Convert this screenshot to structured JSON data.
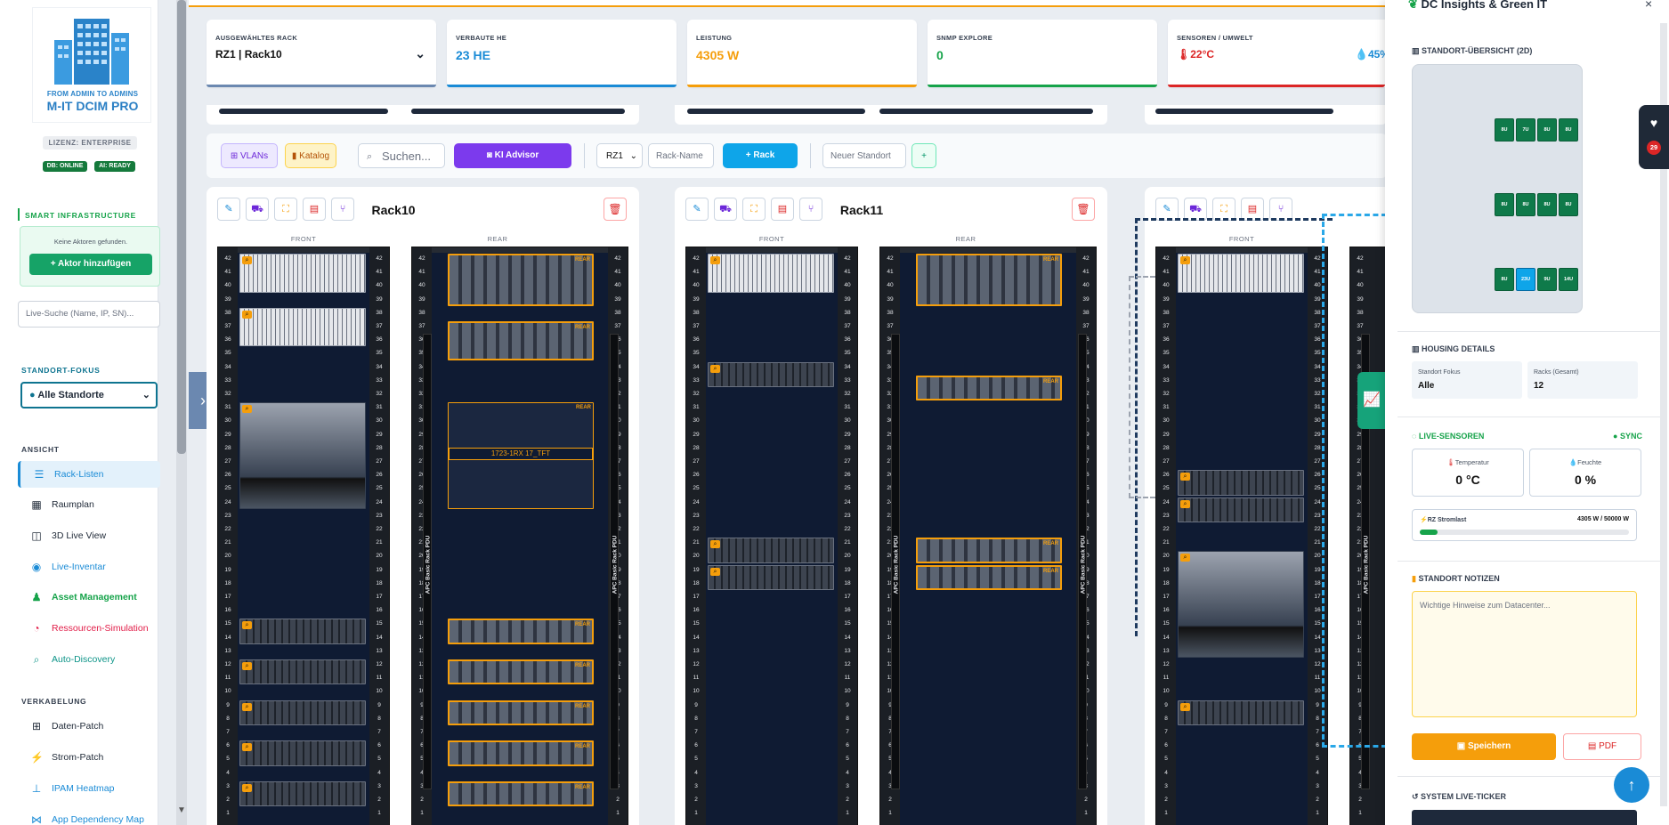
{
  "sidebar": {
    "logo": {
      "tagline": "FROM ADMIN TO ADMINS",
      "name": "M-IT DCIM PRO"
    },
    "license": "LIZENZ: ENTERPRISE",
    "db_status": "DB: ONLINE",
    "ai_status": "AI: READY",
    "smart_title": "SMART INFRASTRUCTURE",
    "smart_empty": "Keine Aktoren gefunden.",
    "add_actor": "+ Aktor hinzufügen",
    "live_search_placeholder": "Live-Suche (Name, IP, SN)...",
    "location_focus_title": "STANDORT-FOKUS",
    "location_focus_value": "Alle Standorte",
    "view_title": "ANSICHT",
    "view_items": [
      "Rack-Listen",
      "Raumplan",
      "3D Live View",
      "Live-Inventar",
      "Asset Management",
      "Ressourcen-Simulation",
      "Auto-Discovery"
    ],
    "cabling_title": "VERKABELUNG",
    "cabling_items": [
      "Daten-Patch",
      "Strom-Patch",
      "IPAM Heatmap",
      "App Dependency Map"
    ]
  },
  "stats": {
    "rack_label": "AUSGEWÄHLTES RACK",
    "rack_value": "RZ1 | Rack10",
    "he_label": "VERBAUTE HE",
    "he_value": "23 HE",
    "power_label": "LEISTUNG",
    "power_value": "4305 W",
    "snmp_label": "SNMP EXPLORE",
    "snmp_value": "0",
    "env_label": "SENSOREN / UMWELT",
    "env_temp": "22°C",
    "env_humidity": "45%"
  },
  "toolbar": {
    "vlans": "VLANs",
    "catalog": "Katalog",
    "search_placeholder": "Suchen...",
    "ki_advisor": "KI Advisor",
    "rz_select": "RZ1",
    "rack_name_placeholder": "Rack-Name",
    "add_rack": "+ Rack",
    "new_location_placeholder": "Neuer Standort",
    "add_location": "+"
  },
  "racks": [
    {
      "name": "Rack10",
      "front_label": "FRONT",
      "rear_label": "REAR",
      "pdu_label": "APC Basic Rack PDU",
      "rear_note": "1723-1RX 17_TFT"
    },
    {
      "name": "Rack11",
      "front_label": "FRONT",
      "rear_label": "REAR",
      "pdu_label": "APC Basic Rack PDU"
    },
    {
      "name": "",
      "front_label": "FRONT",
      "pdu_label": "APC Basic Rack PDU"
    }
  ],
  "rear_tag": "REAR",
  "units_total": 42,
  "panel": {
    "title": "DC Insights & Green IT",
    "close": "×",
    "overview_title": "STANDORT-ÜBERSICHT (2D)",
    "tiles_row1": [
      "8U",
      "7U",
      "8U",
      "8U"
    ],
    "tiles_row2": [
      "8U",
      "8U",
      "8U",
      "8U"
    ],
    "tiles_row3": [
      "8U",
      "23U",
      "9U",
      "14U"
    ],
    "housing_title": "HOUSING DETAILS",
    "focus_label": "Standort Fokus",
    "focus_value": "Alle",
    "racks_label": "Racks (Gesamt)",
    "racks_value": "12",
    "sensors_title": "LIVE-SENSOREN",
    "sync": "SYNC",
    "temp_label": "Temperatur",
    "temp_value": "0 °C",
    "hum_label": "Feuchte",
    "hum_value": "0 %",
    "power_label": "RZ Stromlast",
    "power_value": "4305 W / 50000 W",
    "power_fraction": 0.086,
    "notes_title": "STANDORT NOTIZEN",
    "notes_placeholder": "Wichtige Hinweise zum Datacenter...",
    "save": "Speichern",
    "pdf": "PDF",
    "ticker_title": "SYSTEM LIVE-TICKER",
    "alert_count": "29"
  },
  "colors": {
    "primary": "#1a8bd6",
    "green": "#16a34a",
    "orange": "#f59e0b",
    "red": "#dc2626",
    "purple": "#7c3aed"
  }
}
